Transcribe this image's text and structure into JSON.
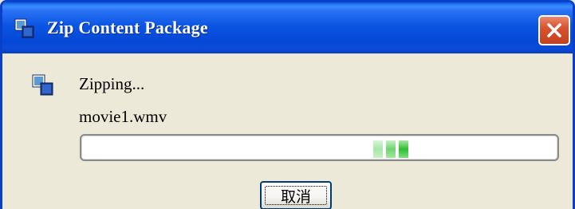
{
  "window": {
    "title": "Zip Content Package",
    "title_icon": "package-app-icon"
  },
  "titlebar": {
    "close_icon": "close-icon",
    "colors": {
      "title_blue": "#0648d6",
      "close_red": "#d9532f"
    }
  },
  "dialog": {
    "icon": "package-app-icon",
    "status_text": "Zipping...",
    "current_file": "movie1.wmv",
    "progress": {
      "style": "marquee",
      "chunk_color": "#2fbf2f"
    },
    "cancel_label": "取消"
  }
}
